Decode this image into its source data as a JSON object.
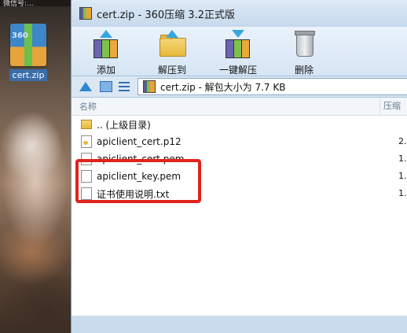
{
  "desktop": {
    "top_text": "微信号:...",
    "icon_label": "cert.zip",
    "icon_badge": "360"
  },
  "window": {
    "title": "cert.zip - 360压缩 3.2正式版"
  },
  "toolbar": {
    "add_label": "添加",
    "extract_to_label": "解压到",
    "one_click_extract_label": "一键解压",
    "delete_label": "删除"
  },
  "addressbar": {
    "path": "cert.zip - 解包大小为 7.7 KB"
  },
  "list": {
    "col_name": "名称",
    "col_size": "压缩",
    "rows": [
      {
        "name": ".. (上级目录)",
        "size": ""
      },
      {
        "name": "apiclient_cert.p12",
        "size": "2."
      },
      {
        "name": "apiclient_cert.pem",
        "size": "1."
      },
      {
        "name": "apiclient_key.pem",
        "size": "1."
      },
      {
        "name": "证书使用说明.txt",
        "size": "1."
      }
    ]
  },
  "colors": {
    "highlight": "#e0231c",
    "window_bg": "#c9dcee"
  }
}
